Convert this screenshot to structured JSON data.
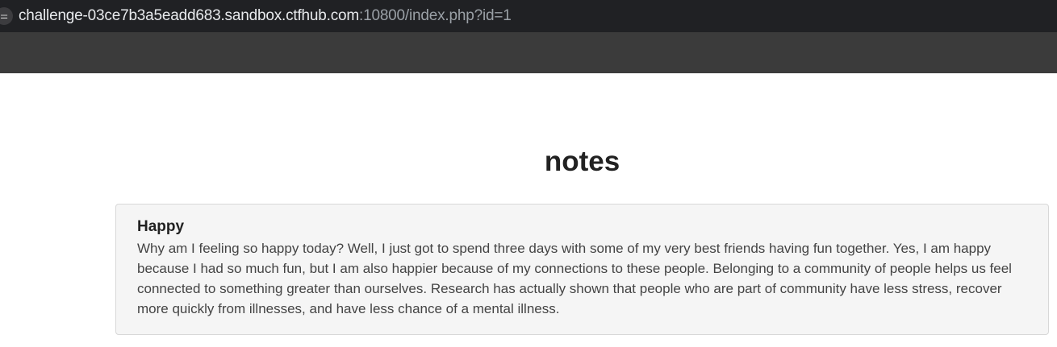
{
  "browser": {
    "site_info_icon": "tune-icon",
    "site_info_glyph": "⚌",
    "url_host": "challenge-03ce7b3a5eadd683.sandbox.ctfhub.com",
    "url_path": ":10800/index.php?id=1"
  },
  "page": {
    "title": "notes",
    "note": {
      "heading": "Happy",
      "body": "Why am I feeling so happy today? Well, I just got to spend three days with some of my very best friends having fun together. Yes, I am happy because I had so much fun, but I am also happier because of my connections to these people. Belonging to a community of people helps us feel connected to something greater than ourselves. Research has actually shown that people who are part of community have less stress, recover more quickly from illnesses, and have less chance of a mental illness."
    }
  },
  "colors": {
    "address_bar_bg": "#202124",
    "toolbar_bg": "#3b3b3b",
    "card_bg": "#f5f5f5",
    "card_border": "#d8d8d8"
  }
}
